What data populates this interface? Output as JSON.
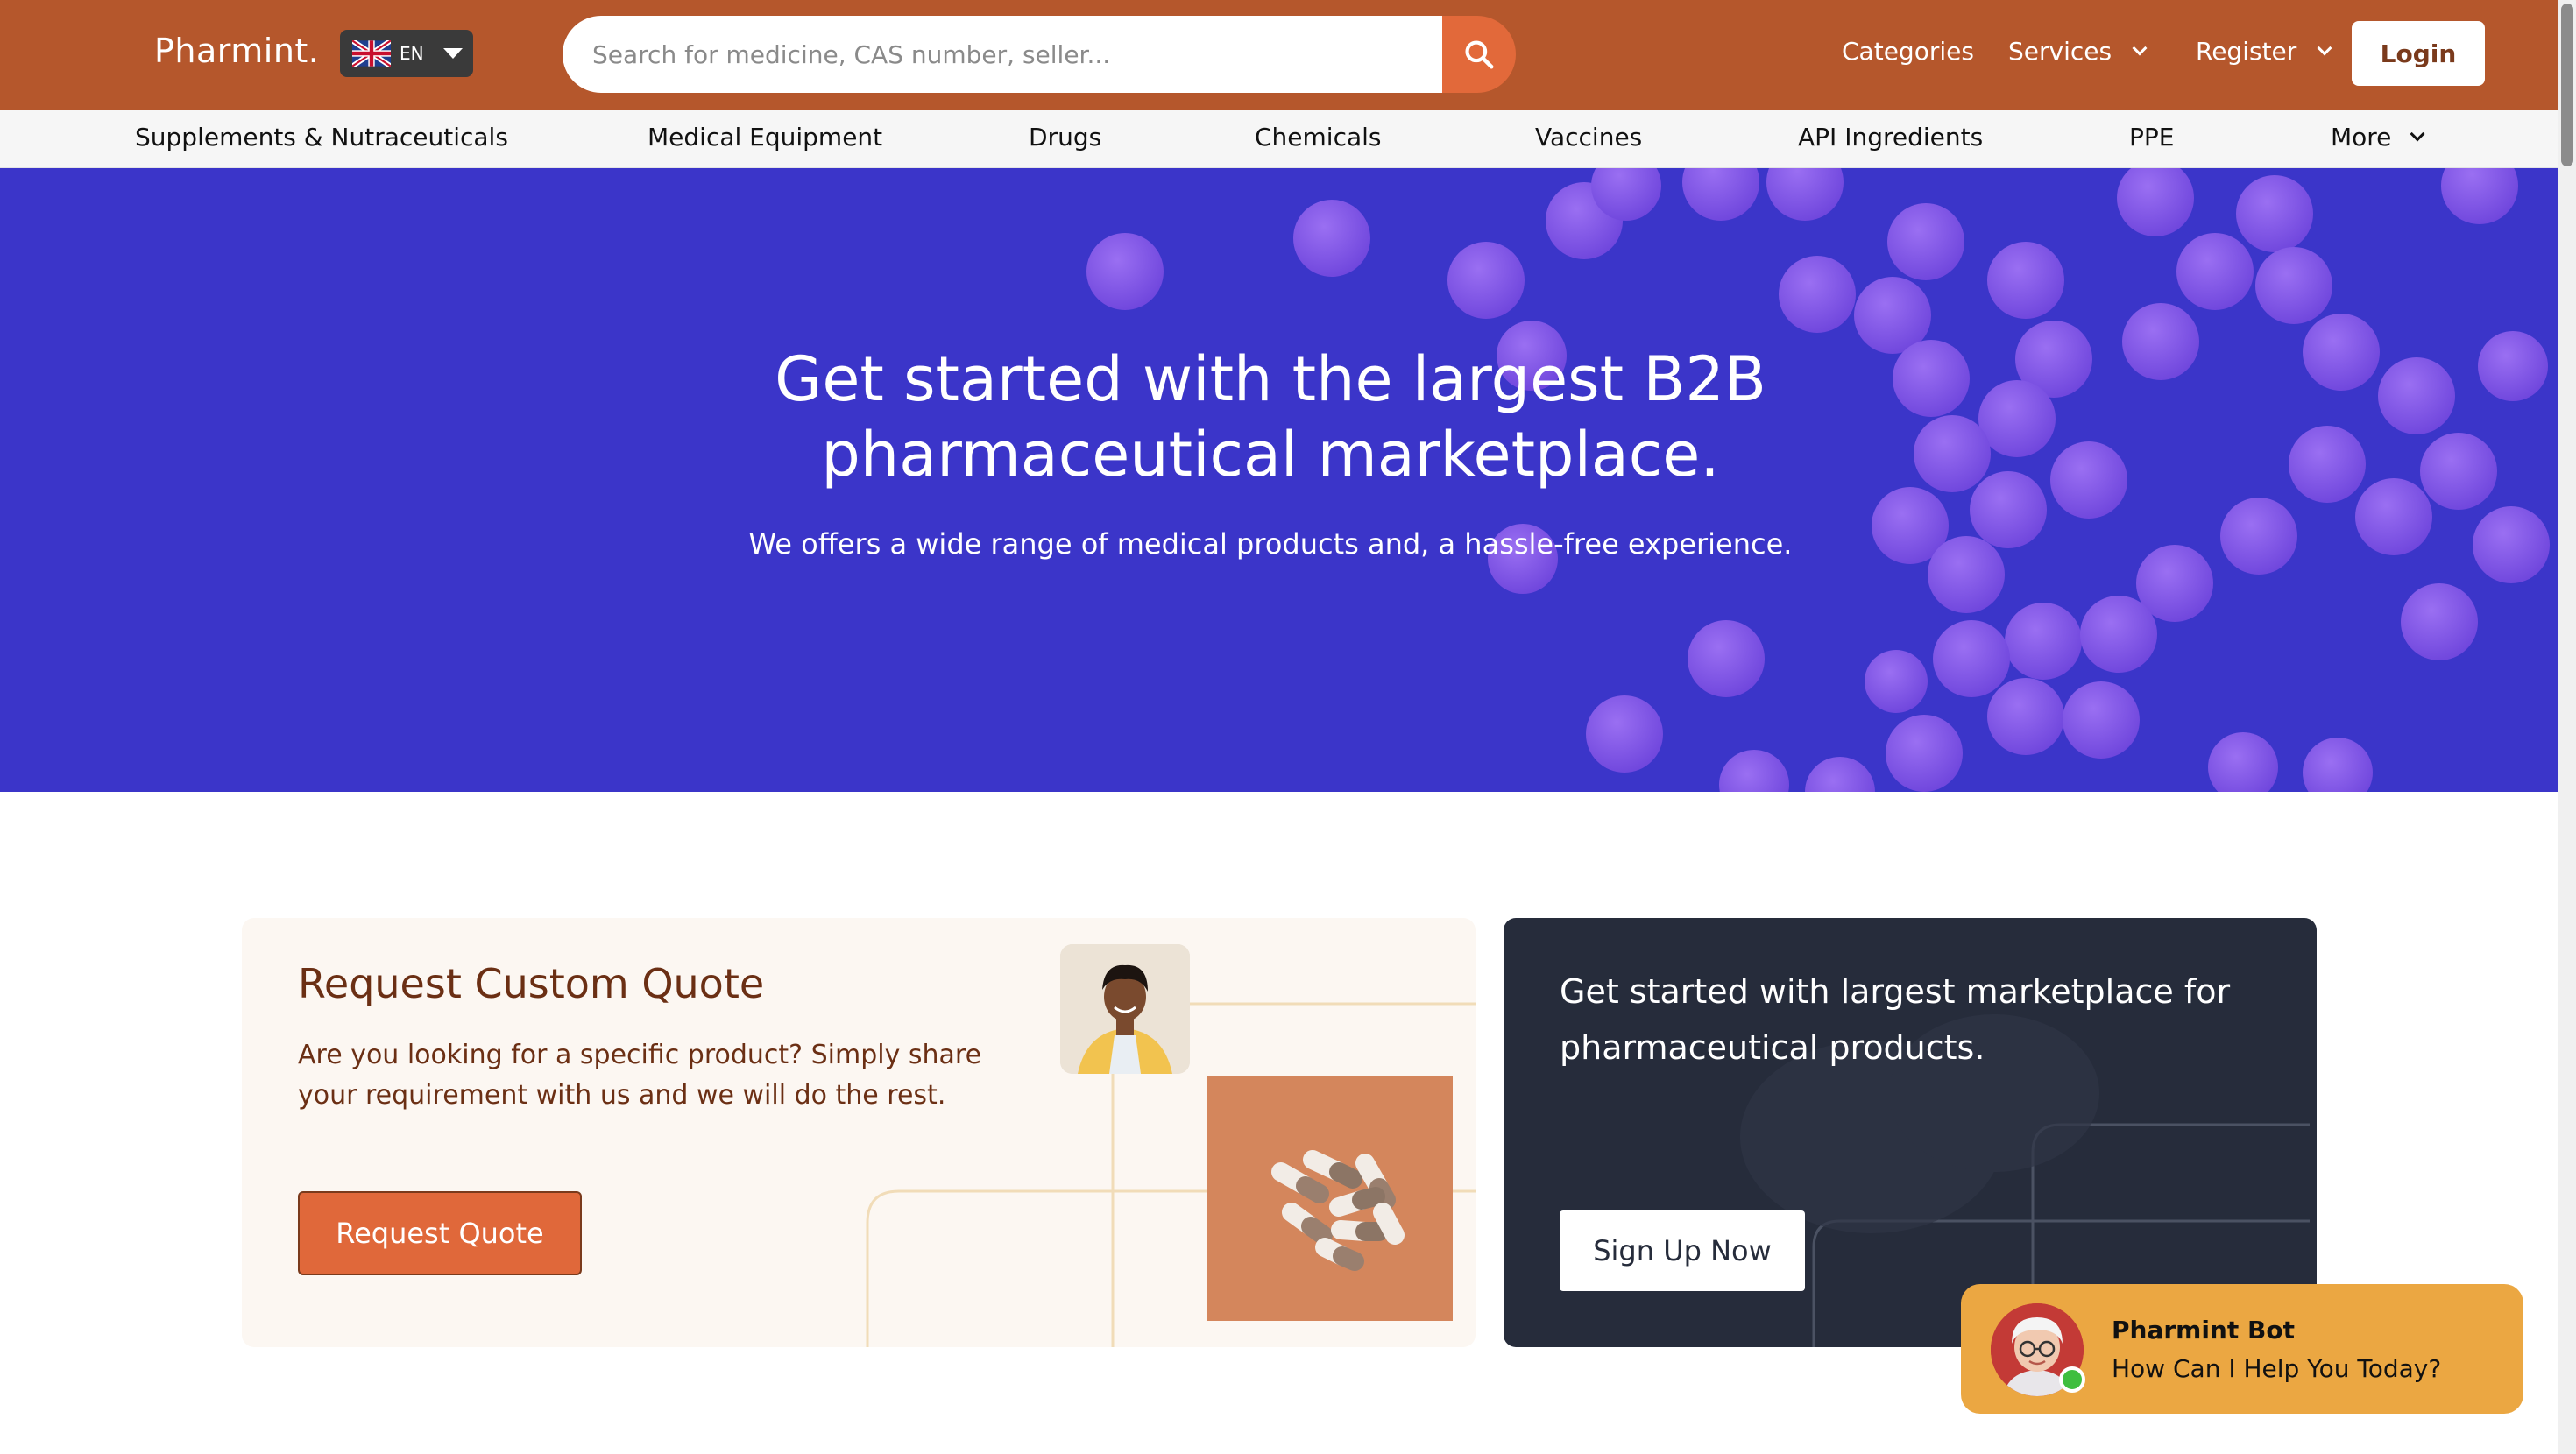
{
  "header": {
    "logo": "Pharmint.",
    "language": "EN",
    "search_placeholder": "Search for medicine, CAS number, seller...",
    "nav": {
      "categories": "Categories",
      "services": "Services",
      "register": "Register",
      "login": "Login"
    }
  },
  "category_bar": {
    "items": [
      "Supplements & Nutraceuticals",
      "Medical Equipment",
      "Drugs",
      "Chemicals",
      "Vaccines",
      "API Ingredients",
      "PPE",
      "More"
    ]
  },
  "hero": {
    "title_line1": "Get started with the largest B2B",
    "title_line2": "pharmaceutical marketplace.",
    "subtitle": "We offers a wide range of medical products and, a hassle-free experience."
  },
  "quote_card": {
    "title": "Request Custom Quote",
    "text": "Are you looking for a specific product? Simply share your requirement with us and we will do the rest.",
    "button": "Request Quote"
  },
  "signup_card": {
    "title": "Get started with largest marketplace for pharmaceutical products.",
    "button": "Sign Up Now"
  },
  "chat_bot": {
    "name": "Pharmint Bot",
    "message": "How Can I Help You Today?"
  },
  "colors": {
    "header_bg": "#b5572c",
    "accent_orange": "#e2693a",
    "hero_bg": "#3b35c9",
    "pill": "#7f55e8",
    "dark_card": "#262c3b",
    "bot_bg": "#eba742"
  }
}
